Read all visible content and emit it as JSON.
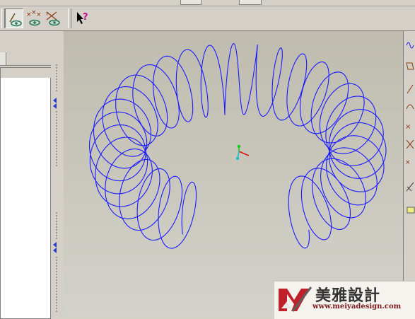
{
  "toolbar": {
    "buttons": [
      {
        "id": "curve-visibility",
        "icon": "curve-eye-icon",
        "pressed": true
      },
      {
        "id": "points-visibility",
        "icon": "points-eye-icon",
        "pressed": false
      },
      {
        "id": "axes-visibility",
        "icon": "axes-eye-icon",
        "pressed": false
      },
      {
        "id": "whats-this",
        "icon": "whats-this-icon",
        "pressed": false
      }
    ]
  },
  "viewport": {
    "curve_color": "#1a1aff",
    "triad": {
      "x_color": "#e01010",
      "y_color": "#10d010",
      "z_color": "#10c0c0"
    }
  },
  "right_toolbar": {
    "icons": [
      "helix-icon",
      "plane-icon",
      "line-icon",
      "arc-icon",
      "point-icon",
      "csys-icon",
      "point-array-icon",
      "dimension-icon",
      "sketch-icon"
    ]
  },
  "watermark": {
    "brand_cn": "美雅設計",
    "url": "www.meiyadesign.com",
    "logo_letter": "M"
  }
}
